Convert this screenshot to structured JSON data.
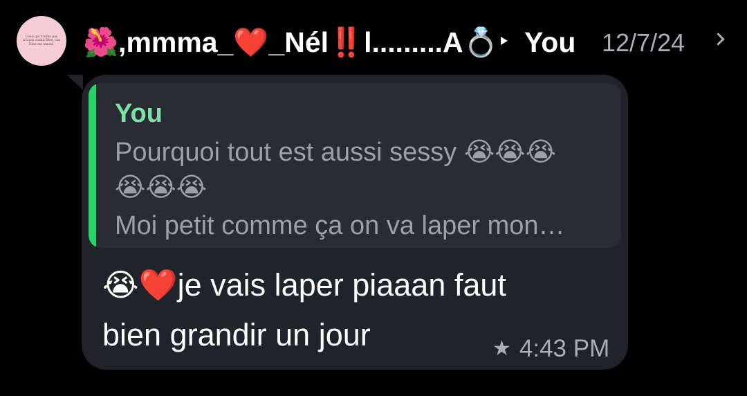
{
  "header": {
    "avatar_text": "Celui qui n'aime pas n'a pas connu Dieu, car Dieu est amour.",
    "sender_name": "🌺,mmma_❤️_Nél‼️l.........A💍",
    "arrow_icon": "play-arrow-icon",
    "recipient": "You",
    "date": "12/7/24",
    "chevron_icon": "chevron-right-icon"
  },
  "quoted": {
    "author": "You",
    "line1": "Pourquoi tout est aussi sessy 😭😭😭",
    "line2": "😭😭😭",
    "line3": "Moi petit comme ça on va laper mon…",
    "accent_color": "#25d366"
  },
  "message": {
    "line1": "😭❤️je vais laper piaaan faut",
    "line2": "bien grandir un jour",
    "starred_icon": "star-icon",
    "time": "4:43 PM"
  }
}
